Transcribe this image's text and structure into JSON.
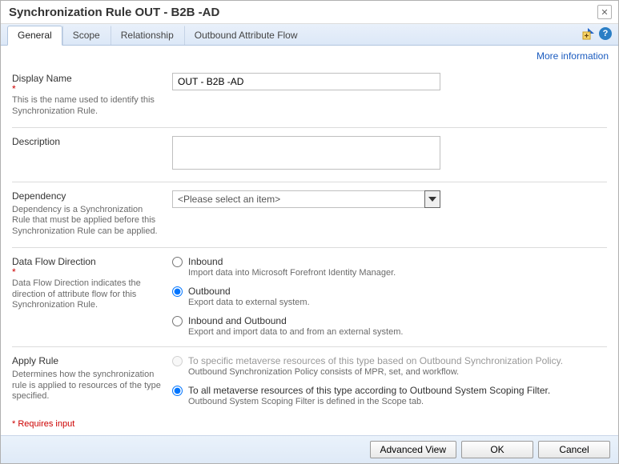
{
  "dialog": {
    "title": "Synchronization Rule OUT - B2B -AD",
    "close_glyph": "✕"
  },
  "tabs": [
    {
      "label": "General"
    },
    {
      "label": "Scope"
    },
    {
      "label": "Relationship"
    },
    {
      "label": "Outbound Attribute Flow"
    }
  ],
  "tabs_right": {
    "help_glyph": "?"
  },
  "more_info_label": "More information",
  "form": {
    "display_name": {
      "label": "Display Name",
      "help": "This is the name used to identify this Synchronization Rule.",
      "value": "OUT - B2B -AD"
    },
    "description": {
      "label": "Description",
      "value": ""
    },
    "dependency": {
      "label": "Dependency",
      "help": "Dependency is a Synchronization Rule that must be applied before this Synchronization Rule can be applied.",
      "placeholder": "<Please select an item>"
    },
    "data_flow": {
      "label": "Data Flow Direction",
      "help": "Data Flow Direction indicates the direction of attribute flow for this Synchronization Rule.",
      "options": [
        {
          "label": "Inbound",
          "help": "Import data into Microsoft Forefront Identity Manager."
        },
        {
          "label": "Outbound",
          "help": "Export data to external system."
        },
        {
          "label": "Inbound and Outbound",
          "help": "Export and import data to and from an external system."
        }
      ],
      "selected_index": 1
    },
    "apply_rule": {
      "label": "Apply Rule",
      "help": "Determines how the synchronization rule is applied to resources of the type specified.",
      "options": [
        {
          "label": "To specific metaverse resources of this type based on Outbound Synchronization Policy.",
          "help": "Outbound Synchronization Policy consists of MPR, set, and workflow."
        },
        {
          "label": "To all metaverse resources of this type according to Outbound System Scoping Filter.",
          "help": "Outbound System Scoping Filter is defined in the Scope tab."
        }
      ],
      "selected_index": 1,
      "disabled_index": 0
    }
  },
  "requires_note": "* Requires input",
  "footer": {
    "advanced": "Advanced View",
    "ok": "OK",
    "cancel": "Cancel"
  }
}
